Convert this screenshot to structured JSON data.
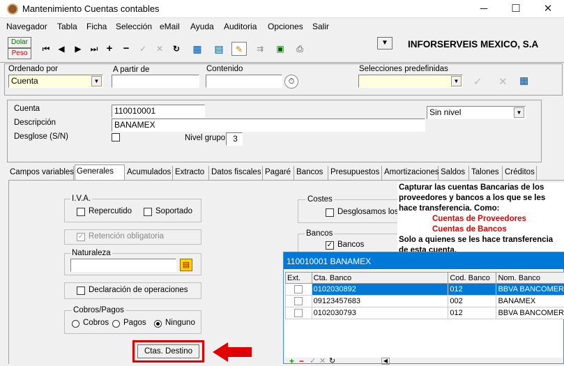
{
  "window": {
    "title": "Mantenimiento Cuentas contables",
    "minimize": "─",
    "maximize": "☐",
    "close": "✕"
  },
  "menu": [
    "Navegador",
    "Tabla",
    "Ficha",
    "Selección",
    "eMail",
    "Ayuda",
    "Auditoria",
    "Opciones",
    "Salir"
  ],
  "toolbar": {
    "dolar": "Dolar",
    "peso": "Peso",
    "company": "INFORSERVEIS MEXICO, S.A"
  },
  "filter": {
    "ordenado_label": "Ordenado por",
    "ordenado_value": "Cuenta",
    "apartir_label": "A partir de",
    "apartir_value": "",
    "contenido_label": "Contenido",
    "contenido_value": "",
    "selecciones_label": "Selecciones predefinidas",
    "selecciones_value": ""
  },
  "record": {
    "cuenta_label": "Cuenta",
    "cuenta_value": "110010001",
    "descripcion_label": "Descripción",
    "descripcion_value": "BANAMEX",
    "desglose_label": "Desglose (S/N)",
    "nivel_label": "Nivel grupo",
    "nivel_value": "3",
    "nivel_select": "Sin nivel"
  },
  "tabs": [
    "Campos variables",
    "Generales",
    "Acumulados",
    "Extracto",
    "Datos fiscales",
    "Pagaré",
    "Bancos",
    "Presupuestos",
    "Amortizaciones",
    "Saldos",
    "Talones",
    "Créditos"
  ],
  "generales": {
    "iva_label": "I.V.A.",
    "repercutido": "Repercutido",
    "soportado": "Soportado",
    "retencion": "Retención obligatoria",
    "naturaleza_label": "Naturaleza",
    "naturaleza_value": "",
    "declaracion": "Declaración de operaciones",
    "cobros_label": "Cobros/Pagos",
    "cobros": "Cobros",
    "pagos": "Pagos",
    "ninguno": "Ninguno",
    "ctas_destino": "Ctas. Destino",
    "costes_label": "Costes",
    "desglosamos": "Desglosamos los c",
    "bancos_label": "Bancos",
    "bancos": "Bancos"
  },
  "subwindow": {
    "title": "110010001 BANAMEX",
    "columns": [
      "Ext.",
      "Cta. Banco",
      "Cod. Banco",
      "Nom. Banco"
    ],
    "rows": [
      {
        "cta": "0102030892",
        "cod": "012",
        "nom": "BBVA BANCOMER"
      },
      {
        "cta": "09123457683",
        "cod": "002",
        "nom": "BANAMEX"
      },
      {
        "cta": "0102030793",
        "cod": "012",
        "nom": "BBVA BANCOMER"
      }
    ]
  },
  "tooltip": {
    "line1": "Capturar las cuentas Bancarias de los proveedores y bancos a los que se les hace transferencia.  Como:",
    "red1": "Cuentas de Proveedores",
    "red2": "Cuentas de Bancos",
    "line2": "Solo a quienes se les hace transferencia de esta cuenta."
  },
  "colors": {
    "selection": "#0078d7",
    "accent_red": "#e00000",
    "subwindow_title": "#0078d7"
  }
}
